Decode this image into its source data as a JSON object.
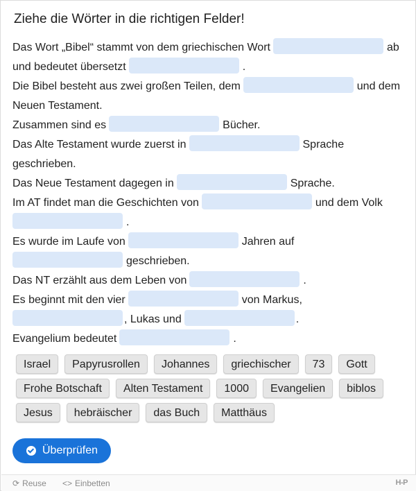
{
  "task_title": "Ziehe die Wörter in die richtigen Felder!",
  "lines": [
    {
      "a": "Das Wort „Bibel“ stammt von dem griechischen Wort",
      "b": "ab"
    },
    {
      "a": "und bedeutet übersetzt",
      "b": "."
    },
    {
      "a": "Die Bibel besteht aus zwei großen Teilen, dem",
      "b": "und dem"
    },
    {
      "a": "Neuen Testament."
    },
    {
      "a": "Zusammen sind es",
      "b": "Bücher."
    },
    {
      "a": "Das Alte Testament wurde zuerst in",
      "b": "Sprache"
    },
    {
      "a": "geschrieben."
    },
    {
      "a": "Das Neue Testament dagegen in",
      "b": "Sprache."
    },
    {
      "a": "Im AT findet man die Geschichten von",
      "b": "und dem Volk"
    },
    {
      "b": "."
    },
    {
      "a": "Es wurde im Laufe von",
      "b": "Jahren auf"
    },
    {
      "b": "geschrieben."
    },
    {
      "a": "Das NT erzählt aus dem Leben von",
      "b": "."
    },
    {
      "a": "Es beginnt mit den vier",
      "b": "von Markus,"
    },
    {
      "b": ", Lukas und",
      "c": "."
    },
    {
      "a": "Evangelium bedeutet",
      "b": "."
    }
  ],
  "words": [
    [
      "Israel",
      "Papyrusrollen",
      "Johannes",
      "griechischer",
      "73",
      "Gott"
    ],
    [
      "Frohe Botschaft",
      "Alten Testament",
      "1000",
      "Evangelien",
      "biblos"
    ],
    [
      "Jesus",
      "hebräischer",
      "das Buch",
      "Matthäus"
    ]
  ],
  "check_button": "Überprüfen",
  "footer": {
    "reuse": "Reuse",
    "embed": "Einbetten",
    "brand": "H-P"
  },
  "colors": {
    "accent": "#1a73d9",
    "dropzone": "#dbe8f9",
    "chip": "#e6e6e6"
  }
}
